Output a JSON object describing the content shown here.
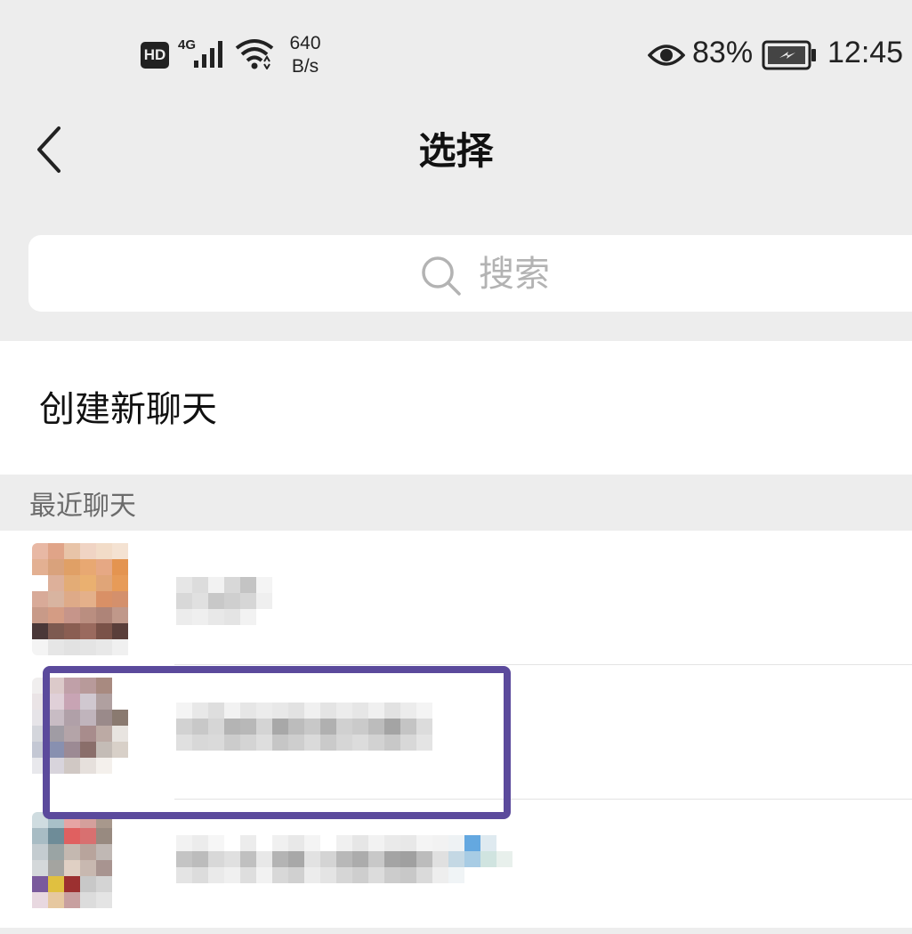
{
  "status_bar": {
    "hd": "HD",
    "network": "4G",
    "speed_value": "640",
    "speed_unit": "B/s",
    "battery_percent": "83%",
    "time": "12:45",
    "icons": [
      "signal-icon",
      "wifi-icon",
      "eye-icon",
      "battery-charging-icon"
    ]
  },
  "nav": {
    "title": "选择",
    "back_icon": "chevron-left-icon"
  },
  "search": {
    "placeholder": "搜索",
    "icon": "search-icon"
  },
  "create_chat": {
    "label": "创建新聊天"
  },
  "recent": {
    "header": "最近聊天"
  },
  "colors": {
    "background": "#ededed",
    "surface": "#ffffff",
    "highlight_border": "#5b4a9c",
    "placeholder": "#b3b3b3",
    "section_header": "#6b6b6b"
  }
}
